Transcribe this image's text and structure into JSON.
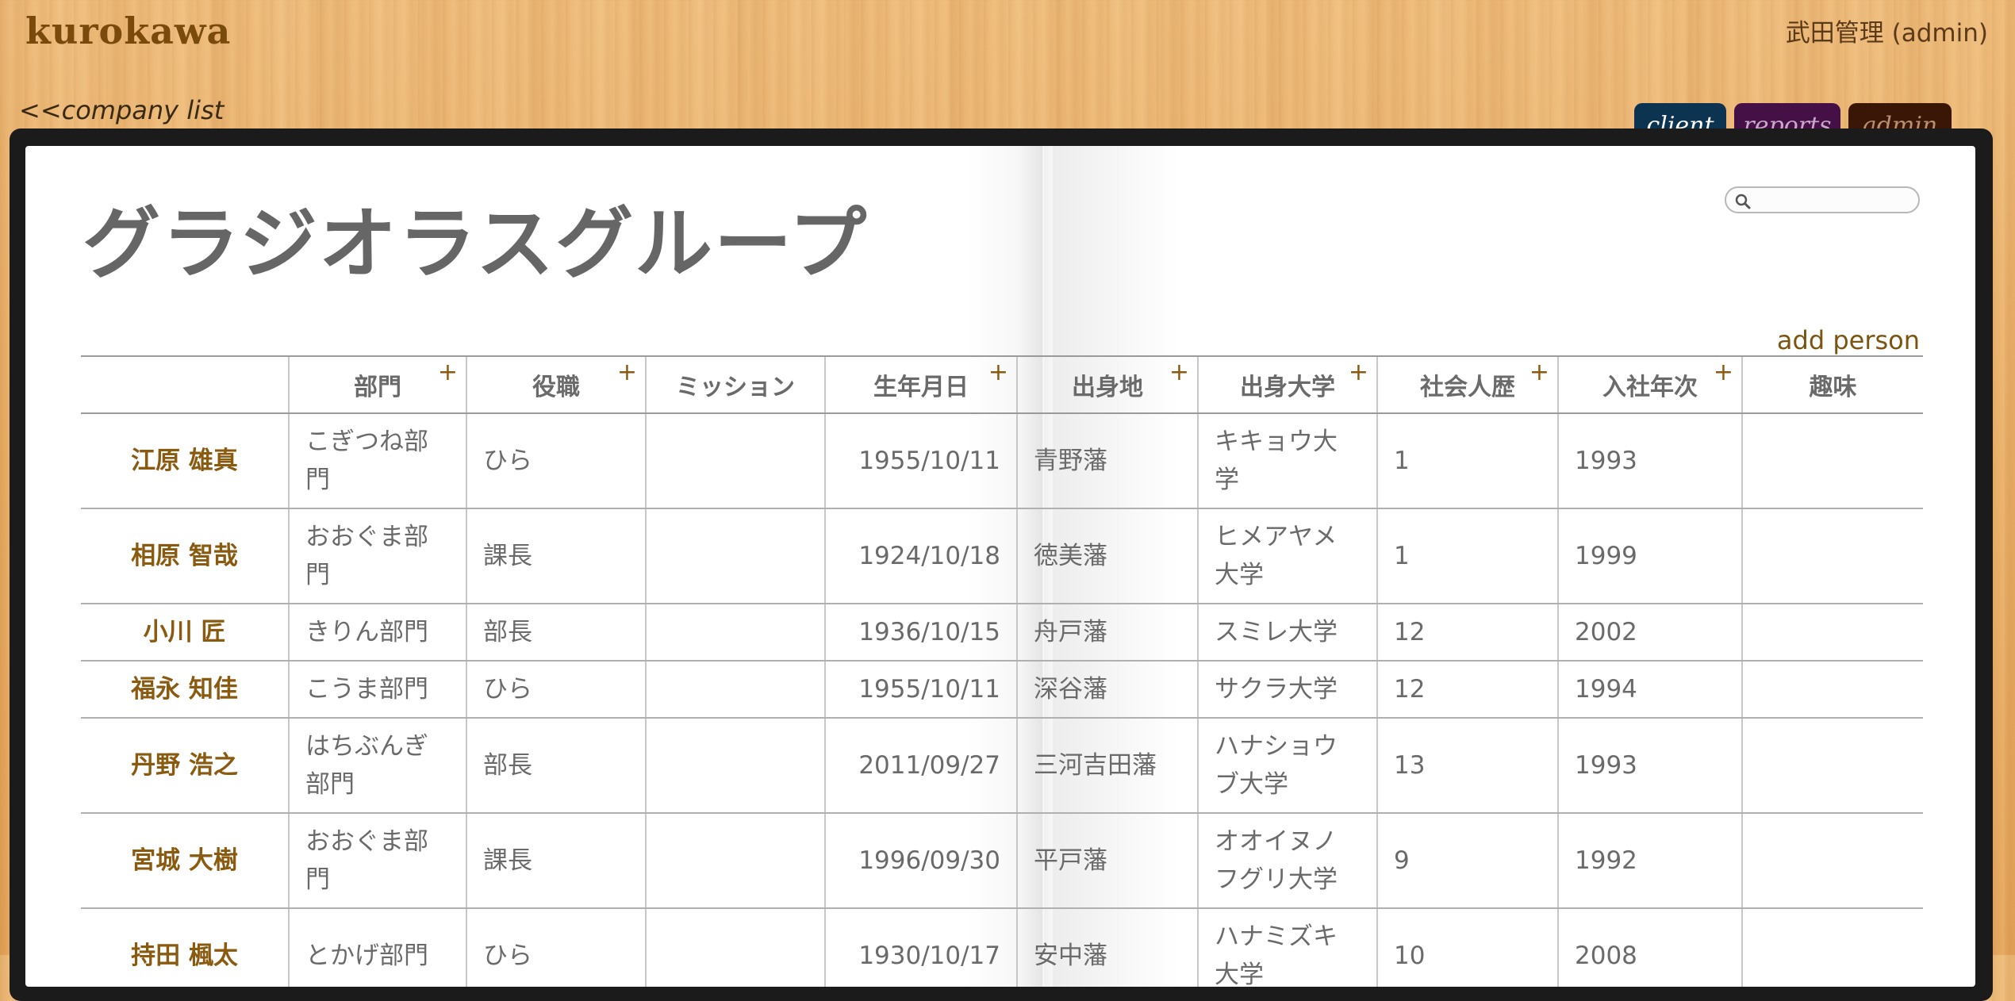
{
  "app": {
    "logo": "kurokawa",
    "user": "武田管理 (admin)",
    "back_link": "<<company list"
  },
  "tabs": [
    {
      "label": "client",
      "active": true
    },
    {
      "label": "reports",
      "active": false
    },
    {
      "label": "admin",
      "active": false
    }
  ],
  "page": {
    "company_name": "グラジオラスグループ",
    "search": {
      "placeholder": "",
      "value": ""
    },
    "add_person": "add person"
  },
  "table": {
    "headers": [
      {
        "label": "",
        "sortable": false
      },
      {
        "label": "部門",
        "sortable": true
      },
      {
        "label": "役職",
        "sortable": true
      },
      {
        "label": "ミッション",
        "sortable": false
      },
      {
        "label": "生年月日",
        "sortable": true
      },
      {
        "label": "出身地",
        "sortable": true
      },
      {
        "label": "出身大学",
        "sortable": true
      },
      {
        "label": "社会人歴",
        "sortable": true
      },
      {
        "label": "入社年次",
        "sortable": true
      },
      {
        "label": "趣味",
        "sortable": false
      }
    ],
    "plus_symbol": "+",
    "rows": [
      {
        "name": "江原 雄真",
        "dept": "こぎつね部門",
        "title": "ひら",
        "mission": "",
        "birth": "1955/10/11",
        "origin": "青野藩",
        "university": "キキョウ大学",
        "career": "1",
        "joined": "1993",
        "hobby": ""
      },
      {
        "name": "相原 智哉",
        "dept": "おおぐま部門",
        "title": "課長",
        "mission": "",
        "birth": "1924/10/18",
        "origin": "徳美藩",
        "university": "ヒメアヤメ大学",
        "career": "1",
        "joined": "1999",
        "hobby": ""
      },
      {
        "name": "小川 匠",
        "dept": "きりん部門",
        "title": "部長",
        "mission": "",
        "birth": "1936/10/15",
        "origin": "舟戸藩",
        "university": "スミレ大学",
        "career": "12",
        "joined": "2002",
        "hobby": ""
      },
      {
        "name": "福永 知佳",
        "dept": "こうま部門",
        "title": "ひら",
        "mission": "",
        "birth": "1955/10/11",
        "origin": "深谷藩",
        "university": "サクラ大学",
        "career": "12",
        "joined": "1994",
        "hobby": ""
      },
      {
        "name": "丹野 浩之",
        "dept": "はちぶんぎ部門",
        "title": "部長",
        "mission": "",
        "birth": "2011/09/27",
        "origin": "三河吉田藩",
        "university": "ハナショウブ大学",
        "career": "13",
        "joined": "1993",
        "hobby": ""
      },
      {
        "name": "宮城 大樹",
        "dept": "おおぐま部門",
        "title": "課長",
        "mission": "",
        "birth": "1996/09/30",
        "origin": "平戸藩",
        "university": "オオイヌノフグリ大学",
        "career": "9",
        "joined": "1992",
        "hobby": ""
      },
      {
        "name": "持田 楓太",
        "dept": "とかげ部門",
        "title": "ひら",
        "mission": "",
        "birth": "1930/10/17",
        "origin": "安中藩",
        "university": "ハナミズキ大学",
        "career": "10",
        "joined": "2008",
        "hobby": ""
      }
    ]
  }
}
